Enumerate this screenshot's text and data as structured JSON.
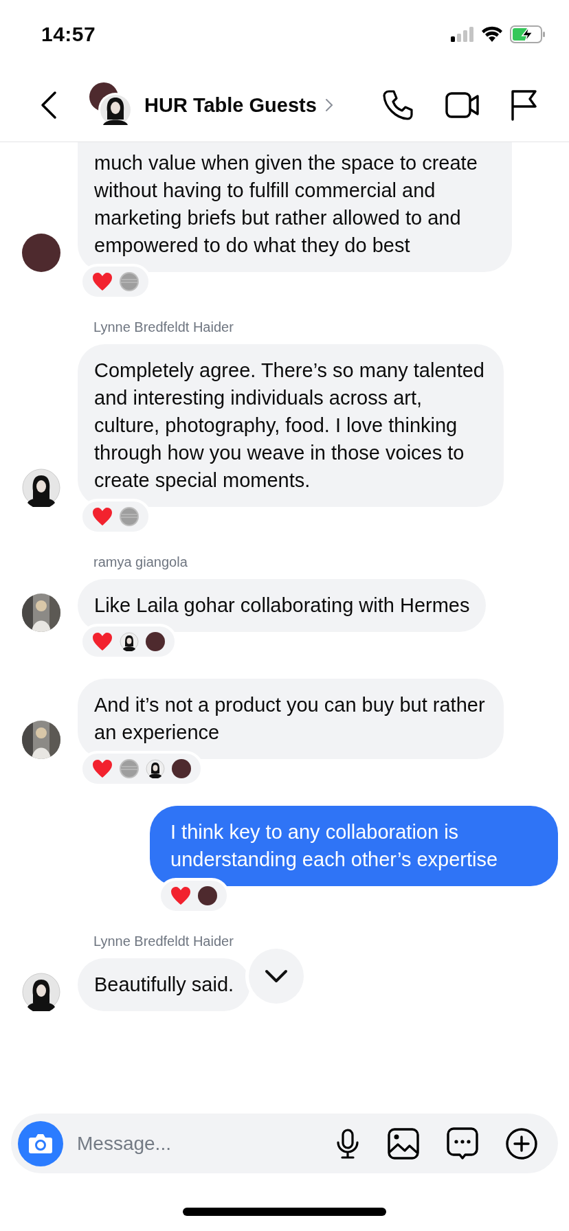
{
  "status_bar": {
    "time": "14:57"
  },
  "header": {
    "title": "HUR Table Guests"
  },
  "messages": [
    {
      "kind": "incoming",
      "avatar": {
        "kind": "maroon"
      },
      "clipped": true,
      "text": "much value when given the space to create without having to fulfill commercial and marketing briefs but rather allowed to and empowered to do what they do best",
      "reactions": [
        {
          "kind": "heart"
        },
        {
          "kind": "grey"
        }
      ]
    },
    {
      "kind": "incoming",
      "sender": "Lynne Bredfeldt Haider",
      "avatar": {
        "kind": "portrait"
      },
      "text": "Completely agree. There’s so many talented and interesting individuals across art, culture, photography, food. I love thinking through how you weave in those voices to create special moments.",
      "reactions": [
        {
          "kind": "heart"
        },
        {
          "kind": "grey"
        }
      ]
    },
    {
      "kind": "incoming",
      "sender": "ramya giangola",
      "avatar": {
        "kind": "photo"
      },
      "text": "Like Laila gohar collaborating with Hermes",
      "reactions": [
        {
          "kind": "heart"
        },
        {
          "kind": "portrait"
        },
        {
          "kind": "maroon"
        }
      ]
    },
    {
      "kind": "incoming",
      "avatar": {
        "kind": "photo"
      },
      "text": "And it’s not a product you can buy but rather an experience",
      "reactions": [
        {
          "kind": "heart"
        },
        {
          "kind": "grey"
        },
        {
          "kind": "portrait"
        },
        {
          "kind": "maroon"
        }
      ]
    },
    {
      "kind": "outgoing",
      "text": "I think key to any collaboration is understanding each other’s expertise",
      "reactions": [
        {
          "kind": "heart"
        },
        {
          "kind": "maroon"
        }
      ]
    },
    {
      "kind": "incoming",
      "sender": "Lynne Bredfeldt Haider",
      "avatar": {
        "kind": "portrait"
      },
      "text": "Beautifully said."
    }
  ],
  "composer": {
    "placeholder": "Message..."
  }
}
